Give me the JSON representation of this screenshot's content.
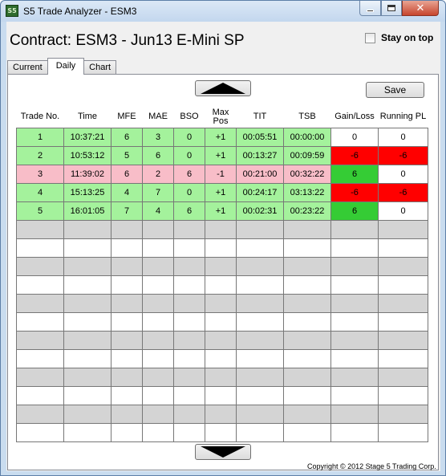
{
  "window": {
    "app_icon_text": "S5",
    "title": "S5 Trade Analyzer - ESM3",
    "min_label": "",
    "max_label": "",
    "close_glyph": "✕"
  },
  "header": {
    "contract": "Contract: ESM3 - Jun13 E-Mini SP",
    "stay_on_top_label": "Stay on top",
    "stay_on_top_checked": false
  },
  "tabs": [
    {
      "label": "Current",
      "active": false
    },
    {
      "label": "Daily",
      "active": true
    },
    {
      "label": "Chart",
      "active": false
    }
  ],
  "toolbar": {
    "save_label": "Save"
  },
  "table": {
    "columns": [
      "Trade No.",
      "Time",
      "MFE",
      "MAE",
      "BSO",
      "Max\nPos",
      "TIT",
      "TSB",
      "Gain/Loss",
      "Running PL"
    ],
    "rows": [
      {
        "style": "green",
        "cells": [
          "1",
          "10:37:21",
          "6",
          "3",
          "0",
          "+1",
          "00:05:51",
          "00:00:00",
          "0",
          "0"
        ],
        "gain_color": "white",
        "pl_color": "white"
      },
      {
        "style": "green",
        "cells": [
          "2",
          "10:53:12",
          "5",
          "6",
          "0",
          "+1",
          "00:13:27",
          "00:09:59",
          "-6",
          "-6"
        ],
        "gain_color": "red",
        "pl_color": "red"
      },
      {
        "style": "pink",
        "cells": [
          "3",
          "11:39:02",
          "6",
          "2",
          "6",
          "-1",
          "00:21:00",
          "00:32:22",
          "6",
          "0"
        ],
        "gain_color": "dgreen",
        "pl_color": "white"
      },
      {
        "style": "green",
        "cells": [
          "4",
          "15:13:25",
          "4",
          "7",
          "0",
          "+1",
          "00:24:17",
          "03:13:22",
          "-6",
          "-6"
        ],
        "gain_color": "red",
        "pl_color": "red"
      },
      {
        "style": "green",
        "cells": [
          "5",
          "16:01:05",
          "7",
          "4",
          "6",
          "+1",
          "00:02:31",
          "00:23:22",
          "6",
          "0"
        ],
        "gain_color": "dgreen",
        "pl_color": "white"
      }
    ],
    "empty_rows": 12
  },
  "colors": {
    "long_row": "#a4f29c",
    "short_row": "#f8bdc8",
    "loss": "#ff0000",
    "gain": "#35cc35",
    "empty_row_gray": "#d4d4d4"
  },
  "footer": {
    "copyright": "Copyright © 2012 Stage 5 Trading Corp."
  }
}
